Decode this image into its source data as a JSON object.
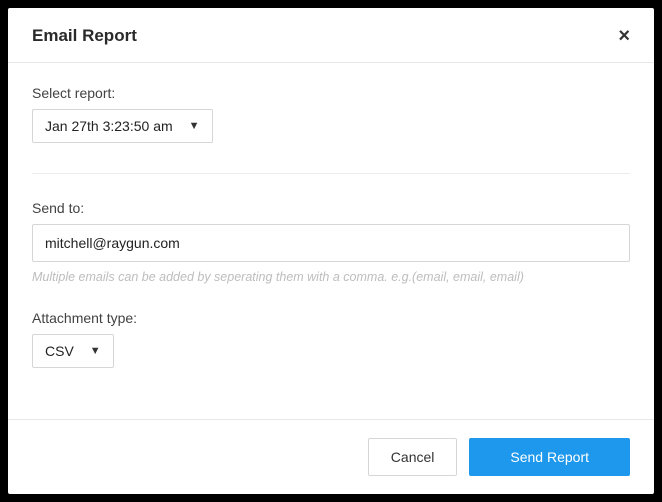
{
  "title": "Email Report",
  "select_report": {
    "label": "Select report:",
    "value": "Jan 27th 3:23:50 am"
  },
  "send_to": {
    "label": "Send to:",
    "value": "mitchell@raygun.com",
    "hint": "Multiple emails can be added by seperating them with a comma. e.g.(email, email, email)"
  },
  "attachment": {
    "label": "Attachment type:",
    "value": "CSV"
  },
  "footer": {
    "cancel": "Cancel",
    "send": "Send Report"
  }
}
